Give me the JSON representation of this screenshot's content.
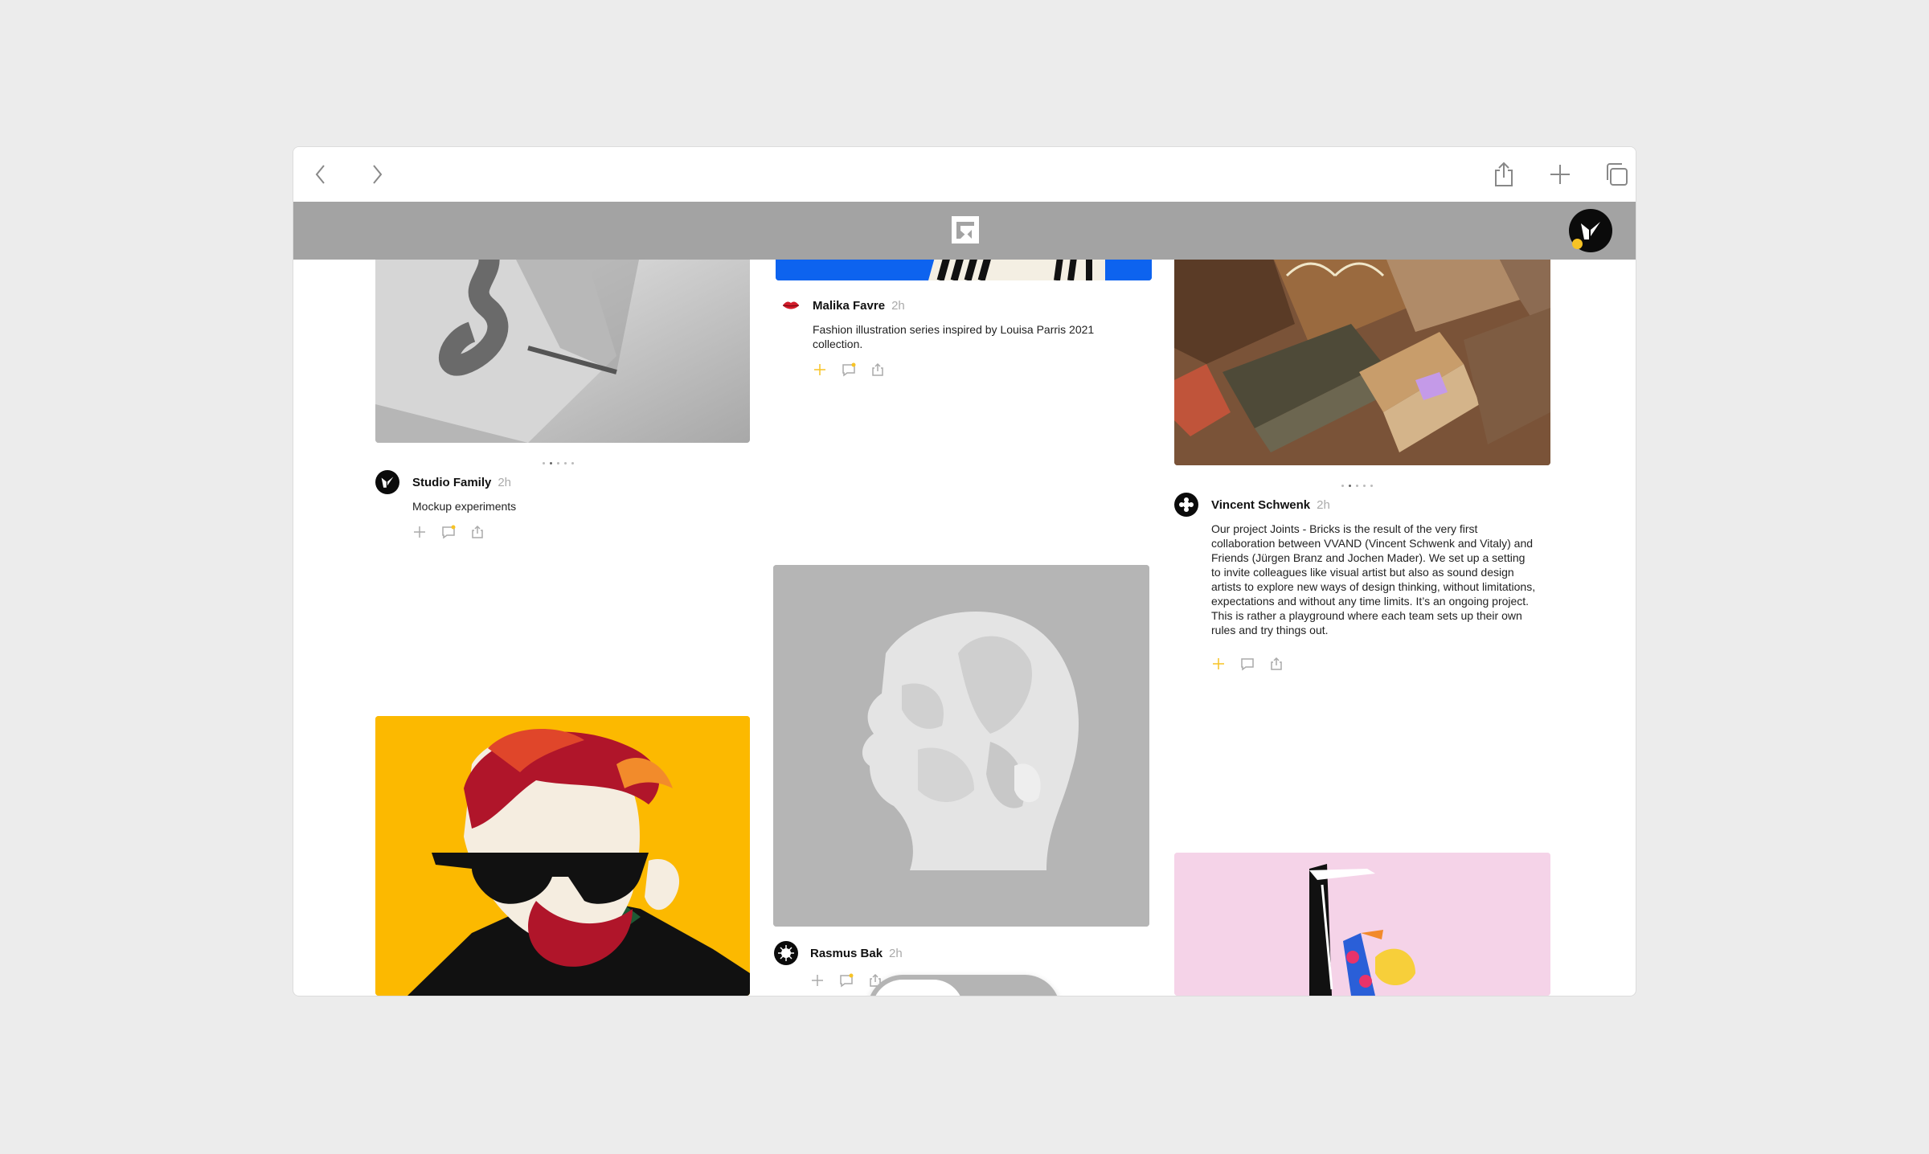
{
  "browser": {
    "back_icon": "chevron-left-icon",
    "forward_icon": "chevron-right-icon",
    "share_icon": "share-icon",
    "new_tab_icon": "plus-icon",
    "tabs_icon": "tabs-icon"
  },
  "app": {
    "logo_icon": "app-logo-icon",
    "user_status_color": "#f7c325"
  },
  "posts": [
    {
      "author": "Studio Family",
      "time": "2h",
      "description": "Mockup experiments"
    },
    {
      "author": "Malika Favre",
      "time": "2h",
      "description": "Fashion illustration series inspired by Louisa Parris 2021 collection."
    },
    {
      "author": "Rasmus Bak",
      "time": "2h",
      "description": ""
    },
    {
      "author": "Vincent Schwenk",
      "time": "2h",
      "description": "Our project Joints - Bricks is the result of the very first collaboration between VVAND (Vincent Schwenk and Vitaly) and Friends (Jürgen Branz and Jochen Mader). We set up a setting to invite colleagues like visual artist but also as sound design artists to explore new ways of design thinking, without limitations, expectations and without any time limits. It’s an ongoing project. This is rather a playground where each team sets up their own rules and try things out."
    }
  ],
  "colors": {
    "accent": "#f7c325",
    "appbar": "#a3a3a3",
    "background": "#ececec"
  },
  "nav": {
    "home_icon": "home-icon",
    "profile_icon": "profile-icon"
  }
}
